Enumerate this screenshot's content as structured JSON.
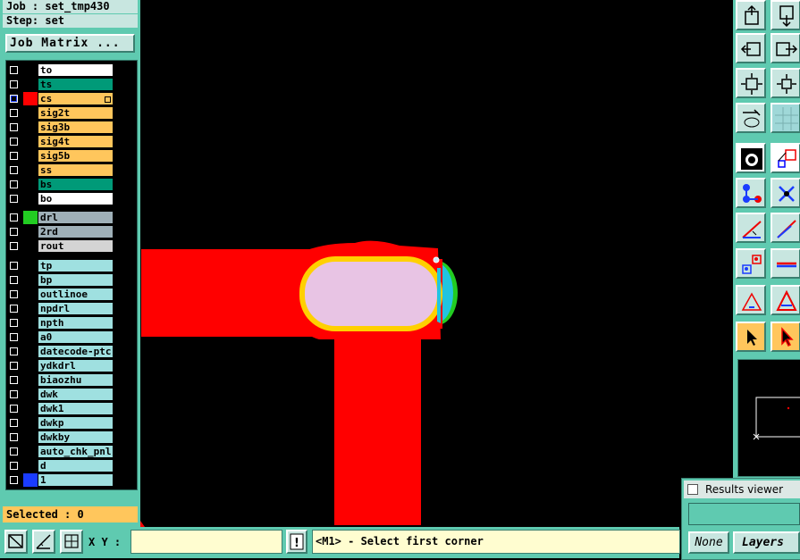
{
  "header": {
    "job_line": "Job : set_tmp430",
    "step_line": "Step: set"
  },
  "job_matrix_label": "Job Matrix ...",
  "layers": [
    {
      "name": "to",
      "swatch": "#000000",
      "bg": "#ffffff"
    },
    {
      "name": "ts",
      "swatch": "#000000",
      "bg": "#009a78"
    },
    {
      "name": "cs",
      "swatch": "#ff0000",
      "bg": "#ffc65c",
      "active": true
    },
    {
      "name": "sig2t",
      "swatch": "#000000",
      "bg": "#ffc65c"
    },
    {
      "name": "sig3b",
      "swatch": "#000000",
      "bg": "#ffc65c"
    },
    {
      "name": "sig4t",
      "swatch": "#000000",
      "bg": "#ffc65c"
    },
    {
      "name": "sig5b",
      "swatch": "#000000",
      "bg": "#ffc65c"
    },
    {
      "name": "ss",
      "swatch": "#000000",
      "bg": "#ffc65c"
    },
    {
      "name": "bs",
      "swatch": "#000000",
      "bg": "#009a78"
    },
    {
      "name": "bo",
      "swatch": "#000000",
      "bg": "#ffffff"
    },
    {
      "name": "drl",
      "swatch": "#22cc22",
      "bg": "#9fb0b8"
    },
    {
      "name": "2rd",
      "swatch": "#000000",
      "bg": "#9fb0b8"
    },
    {
      "name": "rout",
      "swatch": "#000000",
      "bg": "#d4d4d4"
    },
    {
      "name": "tp",
      "swatch": "#000000",
      "bg": "#9fe0e0"
    },
    {
      "name": "bp",
      "swatch": "#000000",
      "bg": "#9fe0e0"
    },
    {
      "name": "outlinoe",
      "swatch": "#000000",
      "bg": "#9fe0e0"
    },
    {
      "name": "npdrl",
      "swatch": "#000000",
      "bg": "#9fe0e0"
    },
    {
      "name": "npth",
      "swatch": "#000000",
      "bg": "#9fe0e0"
    },
    {
      "name": "a0",
      "swatch": "#000000",
      "bg": "#9fe0e0"
    },
    {
      "name": "datecode-ptc",
      "swatch": "#000000",
      "bg": "#9fe0e0"
    },
    {
      "name": "ydkdrl",
      "swatch": "#000000",
      "bg": "#9fe0e0"
    },
    {
      "name": "biaozhu",
      "swatch": "#000000",
      "bg": "#9fe0e0"
    },
    {
      "name": "dwk",
      "swatch": "#000000",
      "bg": "#9fe0e0"
    },
    {
      "name": "dwk1",
      "swatch": "#000000",
      "bg": "#9fe0e0"
    },
    {
      "name": "dwkp",
      "swatch": "#000000",
      "bg": "#9fe0e0"
    },
    {
      "name": "dwkby",
      "swatch": "#000000",
      "bg": "#9fe0e0"
    },
    {
      "name": "auto_chk_pnl",
      "swatch": "#000000",
      "bg": "#9fe0e0"
    },
    {
      "name": "d",
      "swatch": "#000000",
      "bg": "#9fe0e0"
    },
    {
      "name": "1",
      "swatch": "#1a3cff",
      "bg": "#9fe0e0"
    }
  ],
  "selected_label": "Selected : 0",
  "xy_label": "X Y :",
  "xy_value": "",
  "warn_icon_glyph": "!",
  "status_text": "<M1> - Select first corner",
  "results_viewer": {
    "title": "Results viewer",
    "none_label": "None",
    "layers_label": "Layers"
  },
  "colors": {
    "panel": "#5fcab0",
    "copper": "#ff0000",
    "pad": "#e8c4e4",
    "pad_outline": "#ffd000",
    "drill_ring": "#22cc22",
    "drill_fill": "#22c4e0"
  }
}
